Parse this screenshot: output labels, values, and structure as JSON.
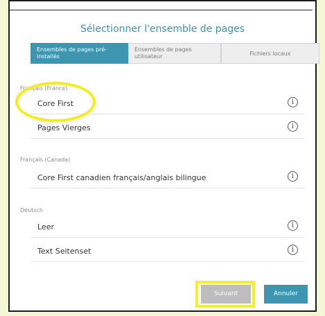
{
  "dialog": {
    "title": "Sélectionner l'ensemble de pages"
  },
  "tabs": [
    {
      "label": "Ensembles de pages pré-installés",
      "active": true
    },
    {
      "label": "Ensembles de pages utilisateur",
      "active": false
    },
    {
      "label": "Fichiers locaux",
      "active": false
    }
  ],
  "groups": [
    {
      "header": "Français (France)",
      "items": [
        "Core First",
        "Pages Vierges"
      ]
    },
    {
      "header": "Français (Canada)",
      "items": [
        "Core First canadien français/anglais bilingue"
      ]
    },
    {
      "header": "Deutsch",
      "items": [
        "Leer",
        "Text Seitenset"
      ]
    }
  ],
  "icons": {
    "info": "info-icon"
  },
  "buttons": {
    "next_label": "Suivant",
    "cancel_label": "Annuler"
  },
  "colors": {
    "accent": "#3d95af",
    "highlight": "#f5ee13",
    "background": "#f5f6d6"
  }
}
